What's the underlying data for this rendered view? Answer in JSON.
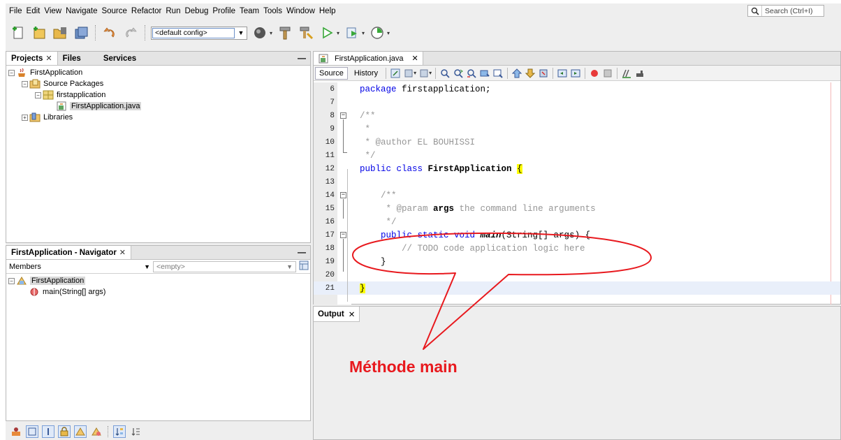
{
  "menubar": {
    "items": [
      "File",
      "Edit",
      "View",
      "Navigate",
      "Source",
      "Refactor",
      "Run",
      "Debug",
      "Profile",
      "Team",
      "Tools",
      "Window",
      "Help"
    ],
    "search_placeholder": "Search (Ctrl+I)"
  },
  "toolbar": {
    "config_value": "<default config>"
  },
  "projects_panel": {
    "tabs": [
      "Projects",
      "Files",
      "Services"
    ],
    "tree": {
      "project": "FirstApplication",
      "source_packages": "Source Packages",
      "package": "firstapplication",
      "file": "FirstApplication.java",
      "libraries": "Libraries"
    }
  },
  "navigator": {
    "title": "FirstApplication - Navigator",
    "filter_label": "Members",
    "filter_value": "<empty>",
    "class_name": "FirstApplication",
    "method": "main(String[] args)"
  },
  "editor": {
    "tab_label": "FirstApplication.java",
    "source_tab": "Source",
    "history_tab": "History",
    "lines": [
      {
        "n": "6",
        "parts": [
          {
            "t": "package ",
            "c": "kw"
          },
          {
            "t": "firstapplication;",
            "c": ""
          }
        ]
      },
      {
        "n": "7",
        "parts": []
      },
      {
        "n": "8",
        "parts": [
          {
            "t": "/**",
            "c": "cm"
          }
        ]
      },
      {
        "n": "9",
        "parts": [
          {
            "t": " *",
            "c": "cm"
          }
        ]
      },
      {
        "n": "10",
        "parts": [
          {
            "t": " * @author EL BOUHISSI",
            "c": "cm"
          }
        ]
      },
      {
        "n": "11",
        "parts": [
          {
            "t": " */",
            "c": "cm"
          }
        ]
      },
      {
        "n": "12",
        "parts": [
          {
            "t": "public class ",
            "c": "kw"
          },
          {
            "t": "FirstApplication",
            "c": "bold"
          },
          {
            "t": " ",
            "c": ""
          },
          {
            "t": "{",
            "c": "brace"
          }
        ]
      },
      {
        "n": "13",
        "parts": []
      },
      {
        "n": "14",
        "parts": [
          {
            "t": "    /**",
            "c": "cm"
          }
        ]
      },
      {
        "n": "15",
        "parts": [
          {
            "t": "     * @param ",
            "c": "cm"
          },
          {
            "t": "args",
            "c": "bold"
          },
          {
            "t": " the command line arguments",
            "c": "cm"
          }
        ]
      },
      {
        "n": "16",
        "parts": [
          {
            "t": "     */",
            "c": "cm"
          }
        ]
      },
      {
        "n": "17",
        "parts": [
          {
            "t": "    public static void ",
            "c": "kw"
          },
          {
            "t": "main",
            "c": "bi"
          },
          {
            "t": "(String[] args) {",
            "c": ""
          }
        ]
      },
      {
        "n": "18",
        "parts": [
          {
            "t": "        // TODO code application logic here",
            "c": "cm"
          }
        ]
      },
      {
        "n": "19",
        "parts": [
          {
            "t": "    }",
            "c": ""
          }
        ]
      },
      {
        "n": "20",
        "parts": []
      },
      {
        "n": "21",
        "parts": [
          {
            "t": "}",
            "c": "brace"
          }
        ]
      }
    ]
  },
  "output": {
    "tab_label": "Output"
  },
  "annotation": {
    "label": "Méthode main",
    "color": "#e8191e"
  }
}
